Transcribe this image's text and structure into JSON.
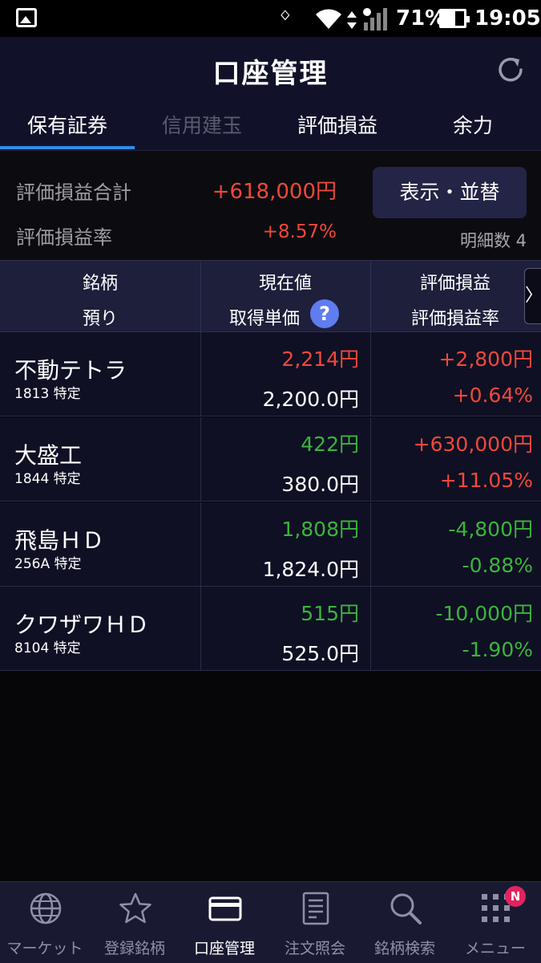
{
  "status_bar": {
    "battery_percent": "71%",
    "time": "19:05"
  },
  "header": {
    "title": "口座管理"
  },
  "tabs": [
    {
      "label": "保有証券",
      "state": "active"
    },
    {
      "label": "信用建玉",
      "state": "disabled"
    },
    {
      "label": "評価損益",
      "state": "normal"
    },
    {
      "label": "余力",
      "state": "normal"
    }
  ],
  "summary": {
    "total_label": "評価損益合計",
    "total_value": "+618,000円",
    "rate_label": "評価損益率",
    "rate_value": "+8.57%",
    "display_button": "表示・並替",
    "detail_count": "明細数 4"
  },
  "table_header": {
    "col1_top": "銘柄",
    "col1_bottom": "預り",
    "col2_top": "現在値",
    "col2_bottom": "取得単価",
    "help": "?",
    "col3_top": "評価損益",
    "col3_bottom": "評価損益率",
    "scroll": "〉"
  },
  "rows": [
    {
      "name": "不動テトラ",
      "code": "1813 特定",
      "price": "2,214円",
      "price_dir": "up",
      "cost": "2,200.0円",
      "pl": "+2,800円",
      "pl_rate": "+0.64%",
      "pl_dir": "up"
    },
    {
      "name": "大盛工",
      "code": "1844 特定",
      "price": "422円",
      "price_dir": "down",
      "cost": "380.0円",
      "pl": "+630,000円",
      "pl_rate": "+11.05%",
      "pl_dir": "up"
    },
    {
      "name": "飛島ＨＤ",
      "code": "256A 特定",
      "price": "1,808円",
      "price_dir": "down",
      "cost": "1,824.0円",
      "pl": "-4,800円",
      "pl_rate": "-0.88%",
      "pl_dir": "down"
    },
    {
      "name": "クワザワＨＤ",
      "code": "8104 特定",
      "price": "515円",
      "price_dir": "down",
      "cost": "525.0円",
      "pl": "-10,000円",
      "pl_rate": "-1.90%",
      "pl_dir": "down"
    }
  ],
  "bottom_nav": [
    {
      "label": "マーケット",
      "icon": "globe-icon"
    },
    {
      "label": "登録銘柄",
      "icon": "star-icon"
    },
    {
      "label": "口座管理",
      "icon": "card-icon"
    },
    {
      "label": "注文照会",
      "icon": "document-icon"
    },
    {
      "label": "銘柄検索",
      "icon": "search-icon"
    },
    {
      "label": "メニュー",
      "icon": "grid-menu-icon"
    }
  ],
  "menu_badge": "N",
  "colors": {
    "up": "#f0483a",
    "down": "#3cb43c",
    "accent": "#2e8ce6",
    "header_bg": "#11112a"
  }
}
